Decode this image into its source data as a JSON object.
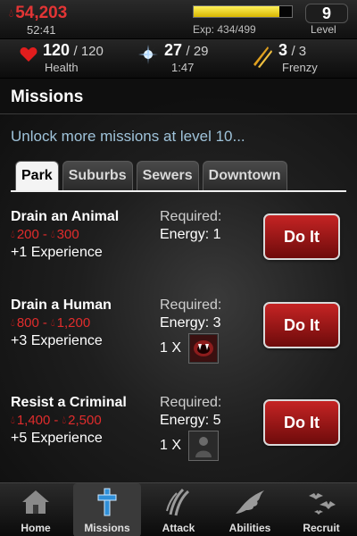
{
  "status": {
    "blood_money": "54,203",
    "timer": "52:41",
    "exp_text": "Exp: 434/499",
    "exp_fraction": 0.87,
    "level_value": "9",
    "level_label": "Level"
  },
  "stats": {
    "health": {
      "value": "120",
      "max": "/ 120",
      "label": "Health"
    },
    "energy": {
      "value": "27",
      "max": "/ 29",
      "timer": "1:47"
    },
    "frenzy": {
      "value": "3",
      "max": "/ 3",
      "label": "Frenzy"
    }
  },
  "missions_page": {
    "title": "Missions",
    "unlock_message": "Unlock more missions at level 10...",
    "tabs": [
      "Park",
      "Suburbs",
      "Sewers",
      "Downtown"
    ],
    "active_tab": "Park"
  },
  "missions": [
    {
      "name": "Drain an Animal",
      "reward_min": "200",
      "reward_sep": "-",
      "reward_max": "300",
      "experience": "+1 Experience",
      "required_label": "Required:",
      "energy": "Energy: 1",
      "button": "Do It"
    },
    {
      "name": "Drain a Human",
      "reward_min": "800",
      "reward_sep": "-",
      "reward_max": "1,200",
      "experience": "+3 Experience",
      "required_label": "Required:",
      "energy": "Energy: 3",
      "item_qty": "1 X",
      "item_icon": "fangs-icon",
      "button": "Do It"
    },
    {
      "name": "Resist a Criminal",
      "reward_min": "1,400",
      "reward_sep": "-",
      "reward_max": "2,500",
      "experience": "+5 Experience",
      "required_label": "Required:",
      "energy": "Energy: 5",
      "item_qty": "1 X",
      "item_icon": "shadow-figure-icon",
      "button": "Do It"
    }
  ],
  "bottom_nav": [
    {
      "label": "Home",
      "icon": "house-icon"
    },
    {
      "label": "Missions",
      "icon": "cross-icon",
      "active": true
    },
    {
      "label": "Attack",
      "icon": "claw-marks-icon"
    },
    {
      "label": "Abilities",
      "icon": "bat-wing-icon"
    },
    {
      "label": "Recruit",
      "icon": "bats-icon"
    }
  ],
  "colors": {
    "blood_red": "#e23535",
    "button_red": "#c52424",
    "link_blue": "#9fc3da",
    "exp_yellow": "#fff25a"
  }
}
